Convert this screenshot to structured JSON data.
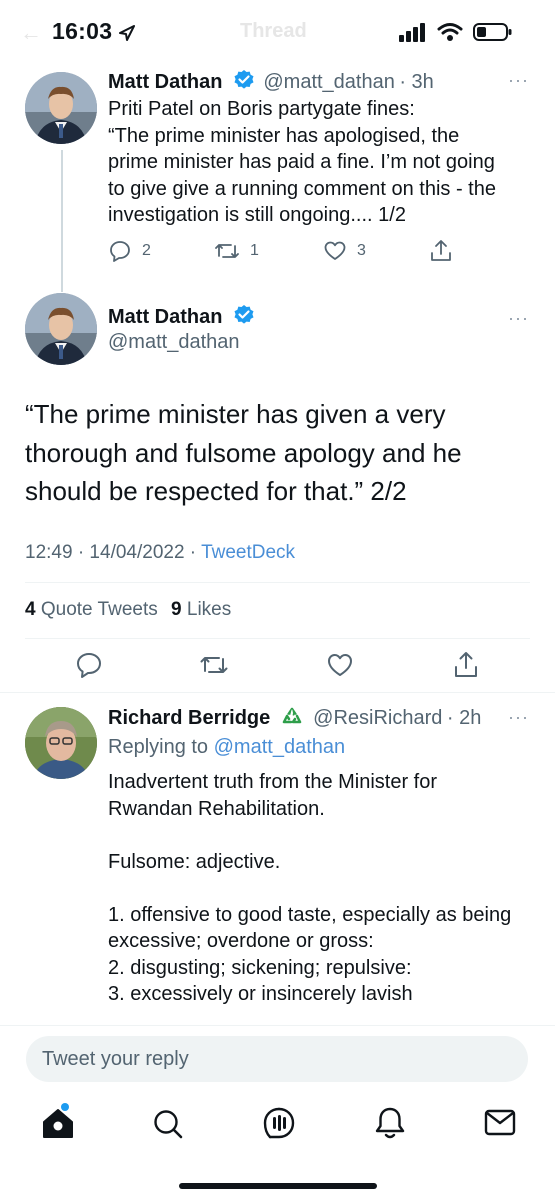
{
  "status_bar": {
    "time": "16:03",
    "header_title": "Thread"
  },
  "tweet1": {
    "author_name": "Matt Dathan",
    "handle": "@matt_dathan",
    "age": "· 3h",
    "lines": [
      "Priti Patel on Boris partygate fines:",
      "“The prime minister has apologised, the",
      "prime minister has paid a fine. I’m not going",
      "to give give a running comment on this - the",
      "investigation is still ongoing.... 1/2"
    ],
    "replies": "2",
    "retweets": "1",
    "likes": "3"
  },
  "main_tweet": {
    "author_name": "Matt Dathan",
    "handle": "@matt_dathan",
    "lines": [
      "“The prime minister has given a very",
      "thorough and fulsome apology and he",
      "should be respected for that.”  2/2"
    ],
    "timestamp": "12:49 · 14/04/2022 ·",
    "source": "TweetDeck",
    "quote_count": "4",
    "quote_label": "Quote Tweets",
    "like_count": "9",
    "like_label": "Likes"
  },
  "reply": {
    "author_name": "Richard Berridge",
    "handle": "@ResiRichard",
    "age": "· 2h",
    "replying_prefix": "Replying to",
    "replying_to": "@matt_dathan",
    "lines": [
      "Inadvertent truth from the Minister for",
      "Rwandan Rehabilitation.",
      "",
      "Fulsome: adjective.",
      "",
      "1. offensive to good taste, especially as being",
      "excessive; overdone or gross:",
      "2. disgusting; sickening; repulsive:",
      "3. excessively or insincerely lavish"
    ]
  },
  "composer": {
    "placeholder": "Tweet your reply"
  },
  "nav": {
    "items": [
      "home-icon",
      "search-icon",
      "spaces-icon",
      "notifications-icon",
      "messages-icon"
    ]
  },
  "colors": {
    "text": "#0f1419",
    "secondary": "#536471",
    "link": "#4a8ed6",
    "verified": "#1d9bf0"
  }
}
